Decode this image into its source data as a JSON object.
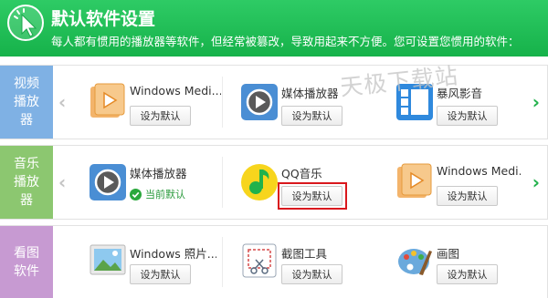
{
  "header": {
    "title": "默认软件设置",
    "description": "每人都有惯用的播放器等软件，但经常被篡改，导致用起来不方便。您可设置您惯用的软件：",
    "bg_color": "#21be57"
  },
  "watermark": "天极下载站",
  "categories": [
    {
      "label": "视频播放器",
      "color": "#7fb1e4",
      "items": [
        {
          "name": "Windows Medi...",
          "icon": "windows-media-player-icon",
          "button": "设为默认"
        },
        {
          "name": "媒体播放器",
          "icon": "media-player-icon",
          "button": "设为默认"
        },
        {
          "name": "暴风影音",
          "icon": "baofeng-icon",
          "button": "设为默认"
        }
      ]
    },
    {
      "label": "音乐播放器",
      "color": "#8cc770",
      "items": [
        {
          "name": "媒体播放器",
          "icon": "media-player-icon",
          "status": "当前默认"
        },
        {
          "name": "QQ音乐",
          "icon": "qq-music-icon",
          "button": "设为默认"
        },
        {
          "name": "Windows Medi...",
          "icon": "windows-media-player-icon",
          "button": "设为默认"
        }
      ]
    },
    {
      "label": "看图软件",
      "color": "#c79ad2",
      "items": [
        {
          "name": "Windows 照片...",
          "icon": "windows-photos-icon",
          "button": "设为默认"
        },
        {
          "name": "截图工具",
          "icon": "snipping-tool-icon",
          "button": "设为默认"
        },
        {
          "name": "画图",
          "icon": "paint-icon",
          "button": "设为默认"
        }
      ]
    }
  ],
  "colors": {
    "accent_green": "#22b14c",
    "highlight_red": "#d9181d"
  }
}
